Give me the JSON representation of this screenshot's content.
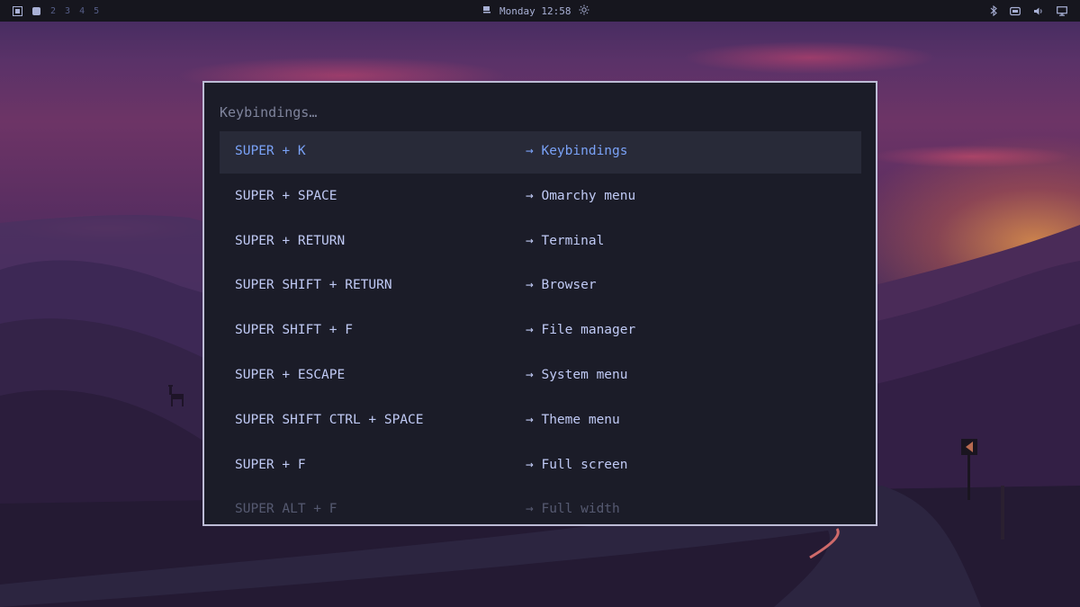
{
  "topbar": {
    "workspaces": [
      {
        "label": "",
        "icon": "workspace-grid-icon"
      },
      {
        "label": "",
        "icon": "workspace-active-dot-icon"
      },
      {
        "label": "2"
      },
      {
        "label": "3"
      },
      {
        "label": "4"
      },
      {
        "label": "5"
      }
    ],
    "clock": "Monday 12:58",
    "status_icons": [
      "bluetooth-icon",
      "network-icon",
      "volume-icon",
      "monitor-icon"
    ]
  },
  "menu": {
    "prompt": "Keybindings…",
    "items": [
      {
        "key": "SUPER + K",
        "action": "→ Keybindings",
        "selected": true
      },
      {
        "key": "SUPER + SPACE",
        "action": "→ Omarchy menu"
      },
      {
        "key": "SUPER + RETURN",
        "action": "→ Terminal"
      },
      {
        "key": "SUPER SHIFT + RETURN",
        "action": "→ Browser"
      },
      {
        "key": "SUPER SHIFT + F",
        "action": "→ File manager"
      },
      {
        "key": "SUPER + ESCAPE",
        "action": "→ System menu"
      },
      {
        "key": "SUPER SHIFT CTRL + SPACE",
        "action": "→ Theme menu"
      },
      {
        "key": "SUPER + F",
        "action": "→ Full screen"
      },
      {
        "key": "SUPER ALT + F",
        "action": "→ Full width"
      }
    ]
  },
  "colors": {
    "menu_bg": "#1b1c28",
    "menu_border": "#bdbcd6",
    "selected_bg": "#282a38",
    "accent": "#7aa2f7",
    "text": "#c0caf5",
    "bar_bg": "#16161e"
  }
}
